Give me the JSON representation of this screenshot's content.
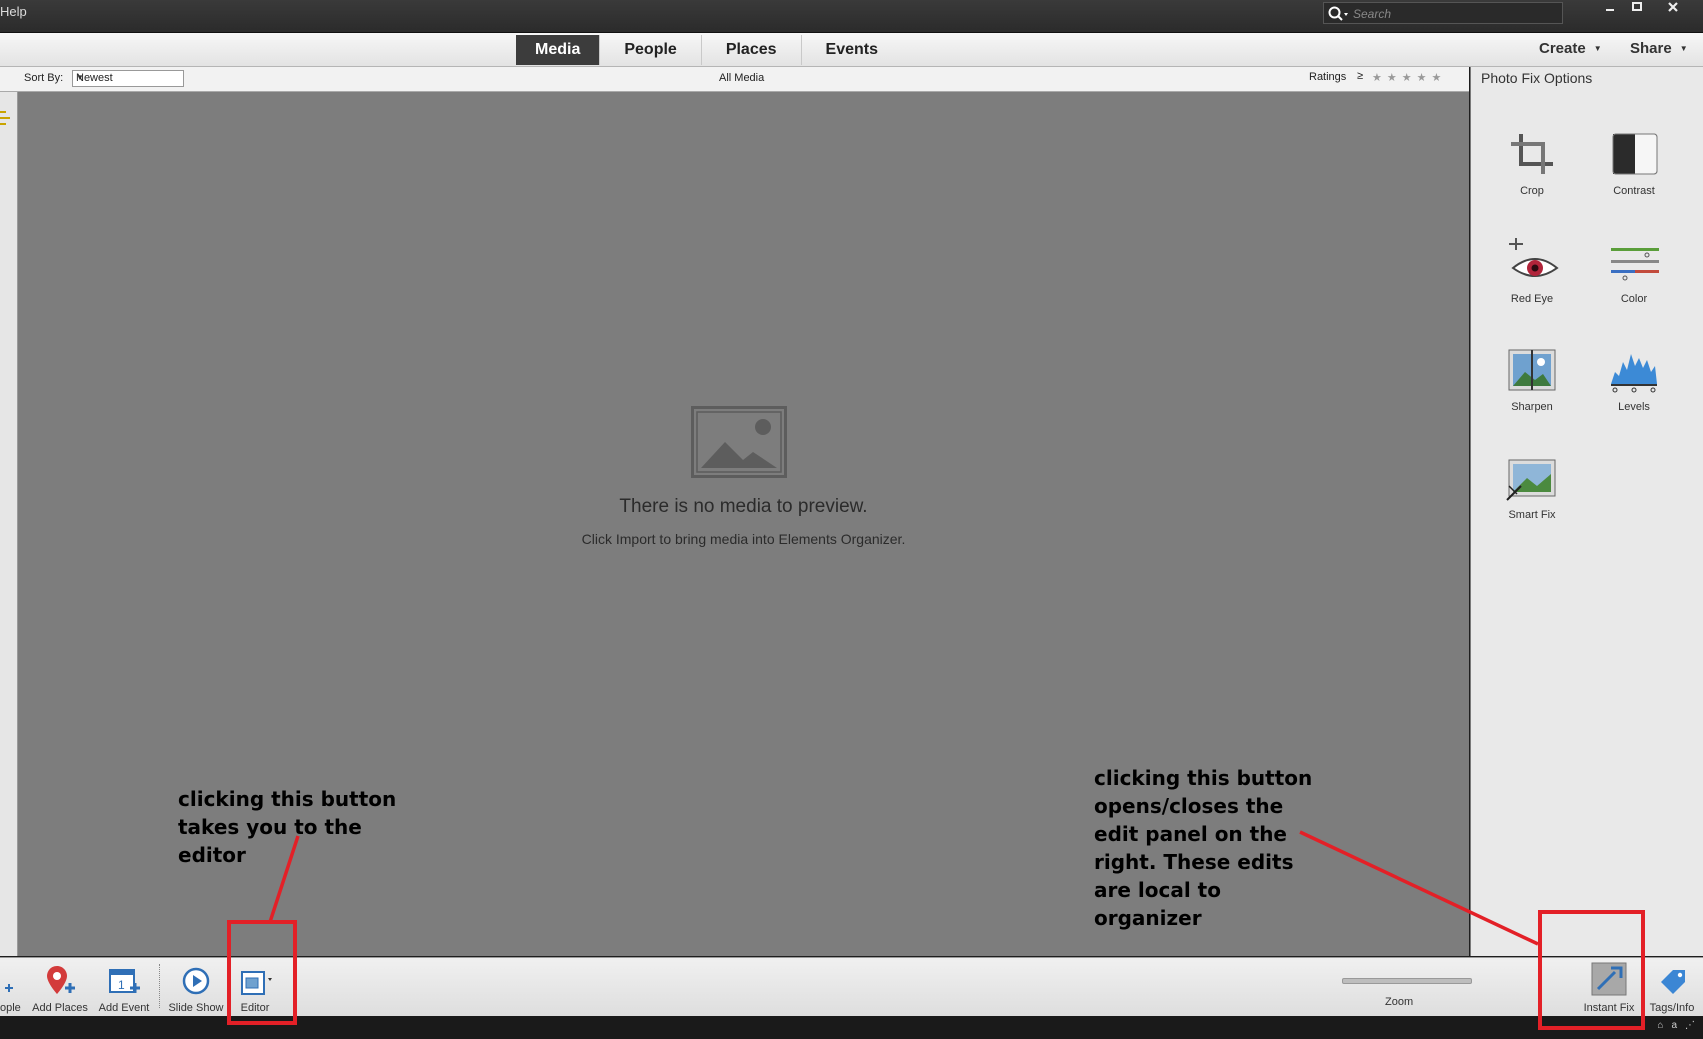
{
  "menu": {
    "help_label": "Help"
  },
  "search": {
    "placeholder": "Search"
  },
  "window_controls": [
    "minimize",
    "maximize",
    "close"
  ],
  "nav": {
    "tabs": [
      {
        "label": "Media",
        "active": true
      },
      {
        "label": "People",
        "active": false
      },
      {
        "label": "Places",
        "active": false
      },
      {
        "label": "Events",
        "active": false
      }
    ],
    "create_label": "Create",
    "share_label": "Share"
  },
  "toolbar": {
    "sort_label": "Sort By:",
    "sort_value": "Newest",
    "view_title": "All Media",
    "ratings_label": "Ratings",
    "ratings_operator": "≥",
    "ratings_stars": 5
  },
  "media": {
    "empty_title": "There is no media to preview.",
    "empty_subtitle": "Click Import to bring media into Elements Organizer."
  },
  "panel": {
    "title": "Photo Fix Options",
    "options": [
      {
        "label": "Crop",
        "icon": "crop-icon"
      },
      {
        "label": "Contrast",
        "icon": "contrast-icon"
      },
      {
        "label": "Red Eye",
        "icon": "red-eye-icon"
      },
      {
        "label": "Color",
        "icon": "color-icon"
      },
      {
        "label": "Sharpen",
        "icon": "sharpen-icon"
      },
      {
        "label": "Levels",
        "icon": "levels-icon"
      },
      {
        "label": "Smart Fix",
        "icon": "smart-fix-icon"
      }
    ]
  },
  "bottombar": {
    "people_label": "ople",
    "add_places_label": "Add Places",
    "add_event_label": "Add Event",
    "slideshow_label": "Slide Show",
    "editor_label": "Editor",
    "zoom_label": "Zoom",
    "instant_fix_label": "Instant Fix",
    "tags_info_label": "Tags/Info"
  },
  "annotations": {
    "left": "clicking this button\ntakes you to the\neditor",
    "right": "clicking this button\nopens/closes the\nedit panel on the\nright. These edits\nare local to\norganizer",
    "color": "#e32027"
  },
  "colors": {
    "media_bg": "#7d7d7d",
    "topbar_bg": "#2b2b2b",
    "active_tab_bg": "#3c3c3c",
    "annotation_red": "#e32027"
  }
}
